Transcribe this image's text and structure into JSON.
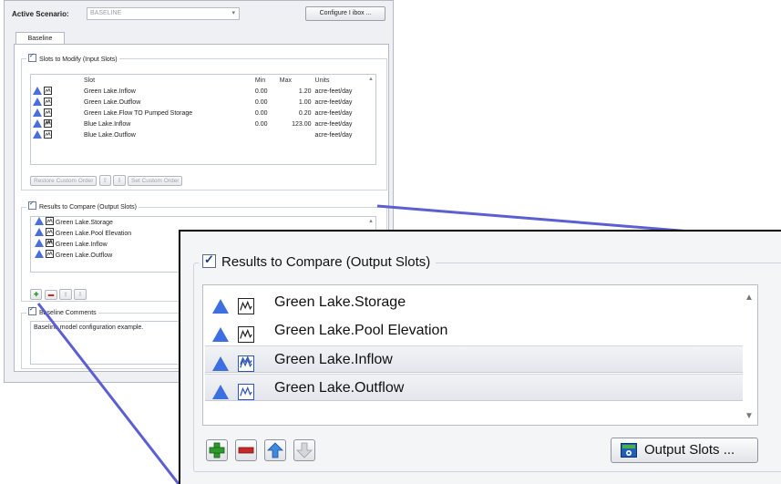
{
  "dialog": {
    "active_scenario_label": "Active Scenario:",
    "active_scenario_value": "BASELINE",
    "configure_button": "Configure I  ibox ...",
    "tab": "Baseline"
  },
  "input_slots": {
    "group_title": "Slots to Modify (Input Slots)",
    "columns": [
      "Slot",
      "Min",
      "Max",
      "Units"
    ],
    "rows": [
      {
        "slot": "Green Lake.Inflow",
        "min": "0.00",
        "max": "1.20",
        "units": "acre-feet/day"
      },
      {
        "slot": "Green Lake.Outflow",
        "min": "0.00",
        "max": "1.00",
        "units": "acre-feet/day"
      },
      {
        "slot": "Green Lake.Flow TO Pumped Storage",
        "min": "0.00",
        "max": "0.20",
        "units": "acre-feet/day"
      },
      {
        "slot": "Blue Lake.Inflow",
        "min": "0.00",
        "max": "123.00",
        "units": "acre-feet/day"
      },
      {
        "slot": "Blue Lake.Outflow",
        "min": "",
        "max": "",
        "units": "acre-feet/day"
      }
    ],
    "restore_button": "Restore Custom Order",
    "set_button": "Set Custom Order"
  },
  "output_slots": {
    "group_title": "Results to Compare (Output Slots)",
    "rows": [
      "Green Lake.Storage",
      "Green Lake.Pool Elevation",
      "Green Lake.Inflow",
      "Green Lake.Outflow"
    ],
    "selected": [
      false,
      false,
      true,
      true
    ],
    "output_slots_button": "Output Slots ..."
  },
  "comments": {
    "group_title": "Baseline Comments",
    "text": "Baseline model configuration example."
  },
  "icons": {
    "object_icon": "blue-triangle-icon",
    "slot_icon": "series-slot-icon",
    "add": "green-plus-icon",
    "remove": "red-minus-icon",
    "up": "blue-up-arrow-icon",
    "down": "grey-down-arrow-icon"
  },
  "colors": {
    "accent_blue": "#3d6fe0",
    "add_green": "#2e9a2e",
    "remove_red": "#c62828",
    "callout_line": "#5b5fd1"
  }
}
